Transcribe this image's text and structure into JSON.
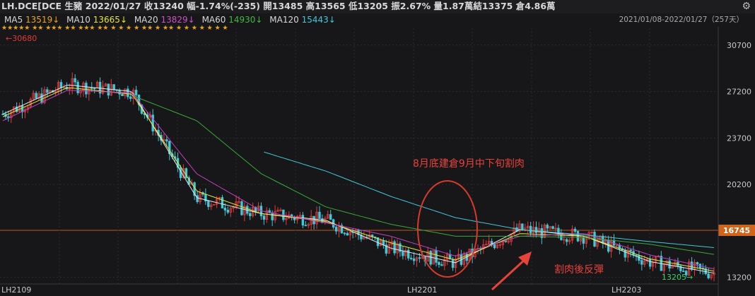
{
  "header": {
    "title": "LH.DCE[DCE 生豬 2022/01/27 收13240 幅-1.74%(-235) 開13485 高13565 低13205 振2.67% 量1.87萬結13375 倉4.86萬"
  },
  "ma_bar": [
    {
      "label": "MA5",
      "value": "13519↓",
      "color": "#e8e8e8"
    },
    {
      "label": "MA10",
      "value": "13665↓",
      "color": "#e6e63a"
    },
    {
      "label": "MA20",
      "value": "13829↓",
      "color": "#c43fc4"
    },
    {
      "label": "MA60",
      "value": "14930↓",
      "color": "#3aa83a"
    },
    {
      "label": "MA120",
      "value": "15443↓",
      "color": "#40c8d8"
    }
  ],
  "date_range": "2021/01/08-2022/01/27（257天）",
  "stars": "★★★★★ ★★ ★★★ ★★ ★★★ ★★ ★ ★ ★ ★ ★★ ★ ★★ ★ ★ ★ ★ ★ ★ ★",
  "annotations": {
    "high_label": "30680",
    "low_label": "13205",
    "text_top": "8月底建倉9月中下旬割肉",
    "text_bottom": "割肉後反彈"
  },
  "colors": {
    "bg": "#17171a",
    "up": "#e23a3a",
    "down": "#3fc8d8",
    "ref": "#c25a20",
    "circle": "#d83a2a"
  },
  "chart_data": {
    "type": "candlestick",
    "y_ticks": [
      30700,
      27200,
      23700,
      20200,
      16745,
      13200
    ],
    "highlight_price": 16745,
    "ylim": [
      12700,
      31700
    ],
    "x_labels": [
      "LH2109",
      "LH2201",
      "LH2203"
    ],
    "series": [
      {
        "name": "MA5",
        "color": "#e8e8e8",
        "values": [
          25500,
          27700,
          27200,
          19200,
          18000,
          17500,
          15400,
          14300,
          16800,
          16300,
          14400,
          13519
        ]
      },
      {
        "name": "MA10",
        "color": "#e6e63a",
        "values": [
          25300,
          27500,
          27000,
          19700,
          18000,
          17400,
          15800,
          14500,
          16500,
          16300,
          14600,
          13665
        ]
      },
      {
        "name": "MA20",
        "color": "#c43fc4",
        "values": [
          25000,
          27300,
          27100,
          21000,
          18200,
          17300,
          16300,
          14800,
          16300,
          16500,
          14900,
          13829
        ]
      },
      {
        "name": "MA60",
        "color": "#3aa83a",
        "values": [
          null,
          null,
          26900,
          25000,
          21000,
          18500,
          17200,
          16300,
          16300,
          16200,
          15700,
          14930
        ]
      },
      {
        "name": "MA120",
        "color": "#40c8d8",
        "values": [
          null,
          null,
          null,
          null,
          22700,
          21200,
          19300,
          17700,
          16800,
          16400,
          15900,
          15443
        ]
      }
    ]
  }
}
